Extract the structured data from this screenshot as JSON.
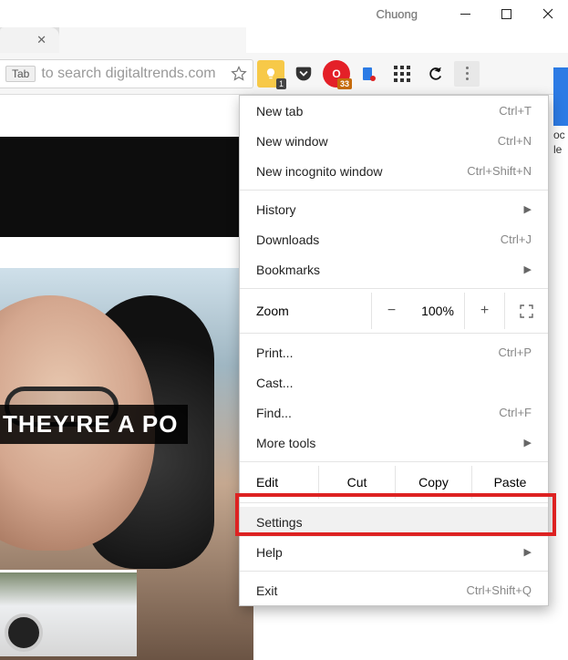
{
  "window": {
    "user": "Chuong"
  },
  "omnibox": {
    "chip": "Tab",
    "hint": "to search digitaltrends.com"
  },
  "extensions": {
    "google_keep_badge": "1",
    "opera_badge": "33"
  },
  "page": {
    "headline": "THEY'RE A PO"
  },
  "side": {
    "line1": "oc",
    "line2": "le"
  },
  "menu": {
    "new_tab": {
      "label": "New tab",
      "shortcut": "Ctrl+T"
    },
    "new_window": {
      "label": "New window",
      "shortcut": "Ctrl+N"
    },
    "incognito": {
      "label": "New incognito window",
      "shortcut": "Ctrl+Shift+N"
    },
    "history": {
      "label": "History"
    },
    "downloads": {
      "label": "Downloads",
      "shortcut": "Ctrl+J"
    },
    "bookmarks": {
      "label": "Bookmarks"
    },
    "zoom": {
      "label": "Zoom",
      "value": "100%"
    },
    "print": {
      "label": "Print...",
      "shortcut": "Ctrl+P"
    },
    "cast": {
      "label": "Cast..."
    },
    "find": {
      "label": "Find...",
      "shortcut": "Ctrl+F"
    },
    "more_tools": {
      "label": "More tools"
    },
    "edit": {
      "label": "Edit",
      "cut": "Cut",
      "copy": "Copy",
      "paste": "Paste"
    },
    "settings": {
      "label": "Settings"
    },
    "help": {
      "label": "Help"
    },
    "exit": {
      "label": "Exit",
      "shortcut": "Ctrl+Shift+Q"
    }
  }
}
